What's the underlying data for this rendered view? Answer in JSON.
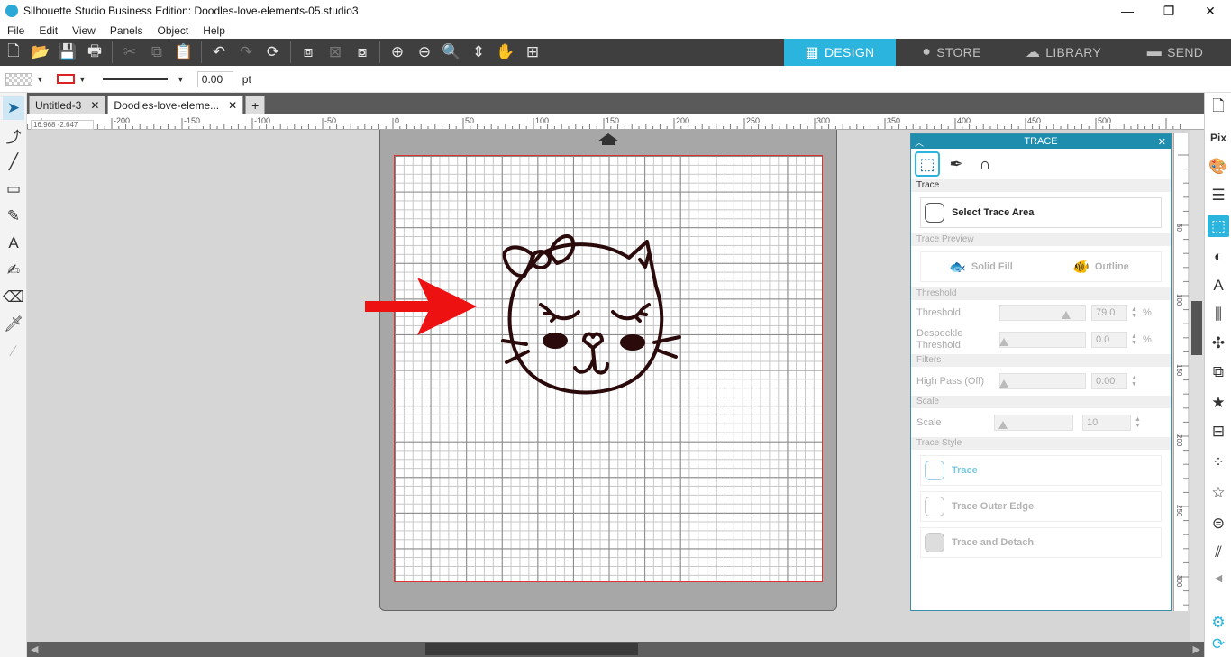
{
  "window": {
    "title": "Silhouette Studio Business Edition: Doodles-love-elements-05.studio3",
    "minimize": "—",
    "restore": "❐",
    "close": "✕"
  },
  "menu": [
    "File",
    "Edit",
    "View",
    "Panels",
    "Object",
    "Help"
  ],
  "nav_tabs": [
    {
      "label": "DESIGN",
      "icon": "grid-icon",
      "active": true
    },
    {
      "label": "STORE",
      "icon": "s-logo-icon",
      "active": false
    },
    {
      "label": "LIBRARY",
      "icon": "cloud-icon",
      "active": false
    },
    {
      "label": "SEND",
      "icon": "cutter-icon",
      "active": false
    }
  ],
  "properties": {
    "line_width": "0.00",
    "unit": "pt"
  },
  "doc_tabs": [
    {
      "label": "Untitled-3",
      "close": "✕",
      "active": false
    },
    {
      "label": "Doodles-love-eleme...",
      "close": "✕",
      "active": true
    }
  ],
  "add_tab": "+",
  "ruler": {
    "coords": "16.968 -2.647",
    "ticks": [
      "-200",
      "-150",
      "-100",
      "-50",
      "0",
      "50",
      "100",
      "150",
      "200",
      "250",
      "300",
      "350",
      "400",
      "450",
      "500"
    ]
  },
  "vertical_ruler": [
    "50",
    "100",
    "150",
    "200",
    "250",
    "300"
  ],
  "trace_panel": {
    "title": "TRACE",
    "sections": {
      "trace": "Trace",
      "preview": "Trace Preview",
      "threshold": "Threshold",
      "filters": "Filters",
      "scale": "Scale",
      "style": "Trace Style"
    },
    "select_area": "Select Trace Area",
    "solid_fill": "Solid Fill",
    "outline": "Outline",
    "threshold_label": "Threshold",
    "threshold_value": "79.0",
    "threshold_pct": 0.79,
    "despeckle_label": "Despeckle Threshold",
    "despeckle_value": "0.0",
    "highpass_label": "High Pass (Off)",
    "highpass_value": "0.00",
    "scale_label": "Scale",
    "scale_value": "10",
    "percent": "%",
    "btn_trace": "Trace",
    "btn_outer": "Trace Outer Edge",
    "btn_detach": "Trace and Detach"
  },
  "colors": {
    "accent": "#2bb5de",
    "panel_header": "#1f8eae",
    "toolbar": "#3f3f3f",
    "arrow": "#ee1111",
    "cat_stroke": "#2a0a0a"
  }
}
